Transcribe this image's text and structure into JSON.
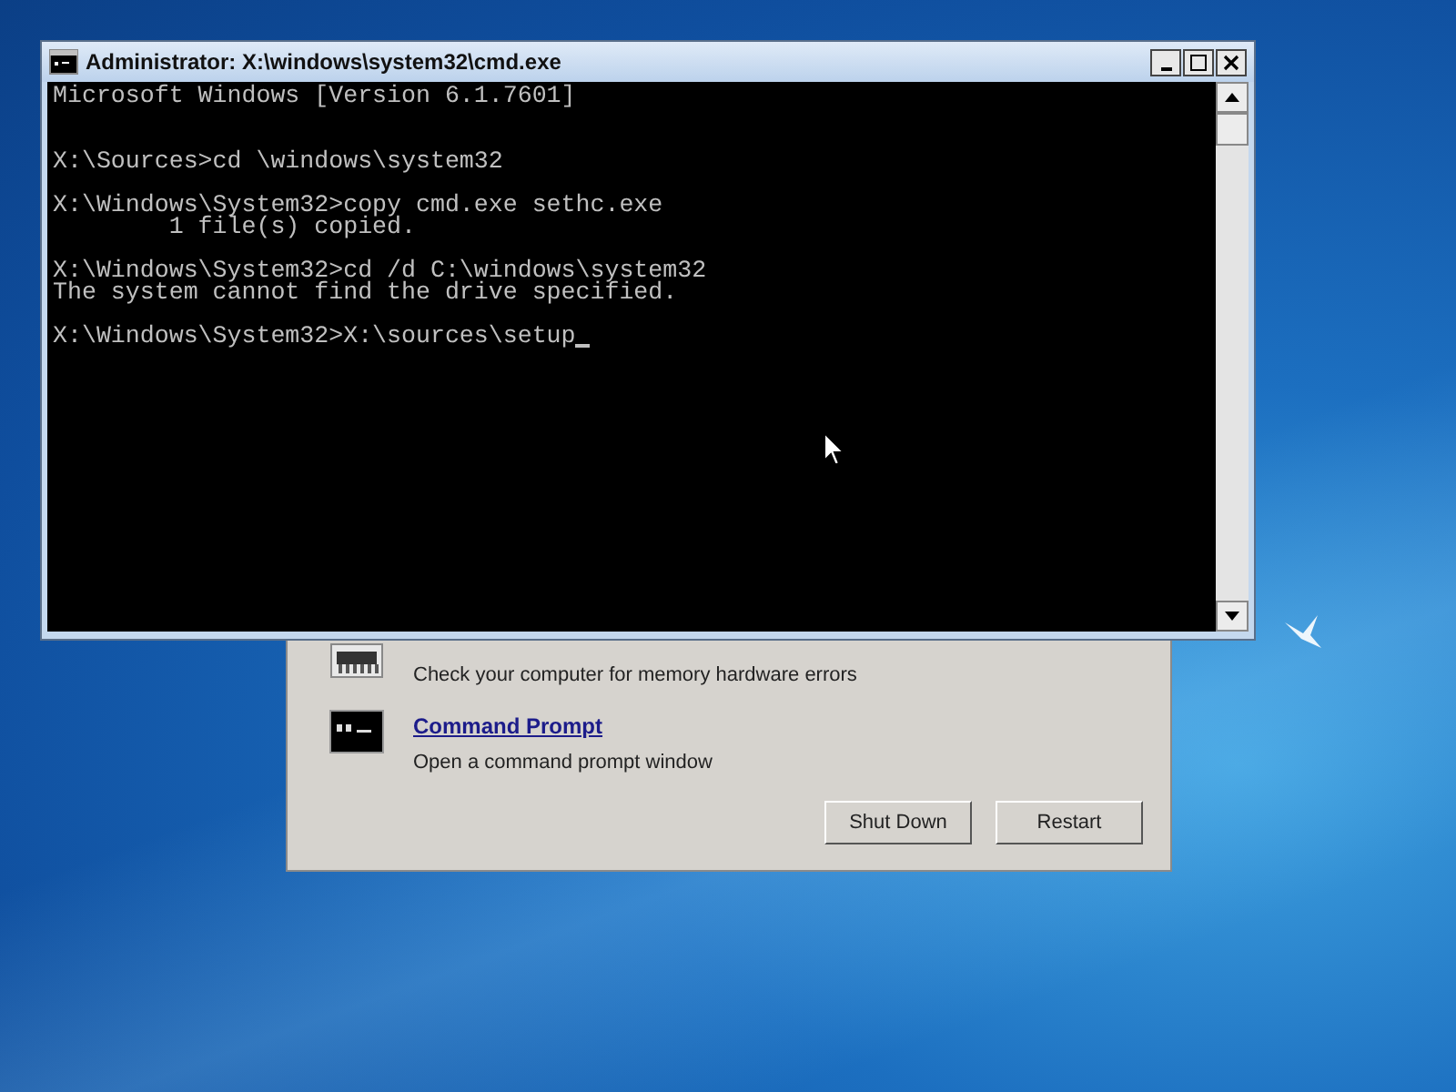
{
  "console_window": {
    "title": "Administrator: X:\\windows\\system32\\cmd.exe",
    "blocks": [
      [
        "Microsoft Windows [Version 6.1.7601]"
      ],
      [
        "X:\\Sources>cd \\windows\\system32"
      ],
      [
        "X:\\Windows\\System32>copy cmd.exe sethc.exe",
        "        1 file(s) copied."
      ],
      [
        "X:\\Windows\\System32>cd /d C:\\windows\\system32",
        "The system cannot find the drive specified."
      ],
      [
        "X:\\Windows\\System32>X:\\sources\\setup"
      ]
    ]
  },
  "recovery_dialog": {
    "items": [
      {
        "kind": "memory",
        "description": "Check your computer for memory hardware errors"
      },
      {
        "kind": "prompt",
        "title": "Command Prompt",
        "description": "Open a command prompt window"
      }
    ],
    "buttons": [
      "Shut Down",
      "Restart"
    ]
  }
}
